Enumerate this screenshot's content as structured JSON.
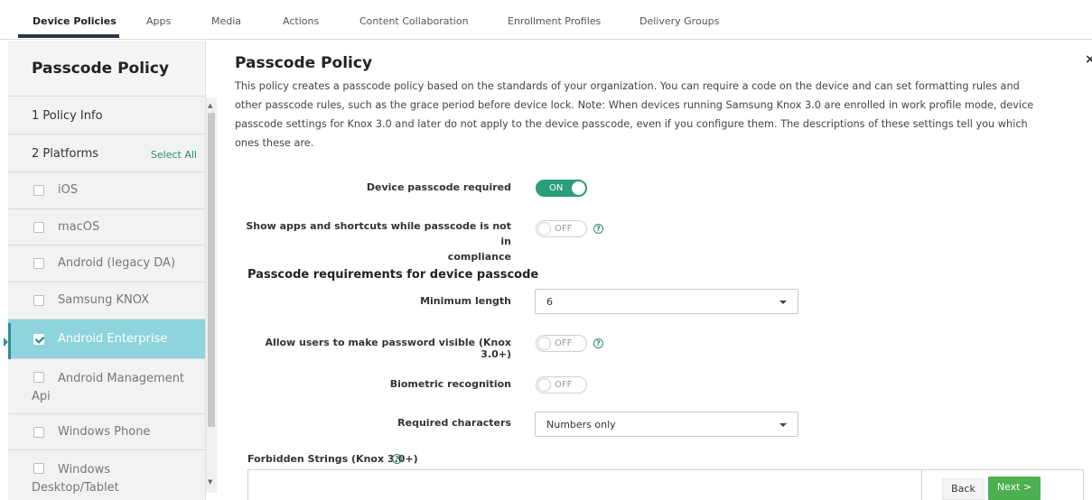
{
  "tabs": [
    "Device Policies",
    "Apps",
    "Media",
    "Actions",
    "Content Collaboration",
    "Enrollment Profiles",
    "Delivery Groups"
  ],
  "sidebar": {
    "title": "Passcode Policy",
    "policy_info": "1  Policy Info",
    "platforms": "2  Platforms",
    "select_all": "Select All",
    "platform_items": [
      "iOS",
      "macOS",
      "Android (legacy DA)",
      "Samsung KNOX",
      "Android Enterprise",
      "Android Management Api",
      "Windows Phone",
      "Windows Desktop/Tablet"
    ],
    "active_item": "Android Enterprise"
  },
  "main": {
    "title": "Passcode Policy",
    "description": "This policy creates a passcode policy based on the standards of your organization. You can require a code on the device and can set formatting rules and other passcode rules, such as the grace period before device lock. Note: When devices running Samsung Knox 3.0 are enrolled in work profile mode, device passcode settings for Knox 3.0 and later do not apply to the device passcode, even if you configure them. The descriptions of these settings tell you which ones these are.",
    "close": "×",
    "device_passcode_required": {
      "label": "Device passcode required",
      "state": "ON"
    },
    "show_apps": {
      "label_line1": "Show apps and shortcuts while passcode is not in",
      "label_line2": "compliance",
      "state": "OFF"
    },
    "section_heading": "Passcode requirements for device passcode",
    "minimum_length": {
      "label": "Minimum length",
      "value": "6"
    },
    "allow_visible": {
      "label": "Allow users to make password visible (Knox 3.0+)",
      "state": "OFF"
    },
    "biometric": {
      "label": "Biometric recognition",
      "state": "OFF"
    },
    "required_chars": {
      "label": "Required characters",
      "value": "Numbers only"
    },
    "forbidden_strings": "Forbidden Strings (Knox 3.0+)"
  },
  "footer": {
    "back": "Back",
    "next": "Next >"
  },
  "colors": {
    "toggle_on": "#2a9d7a",
    "active_item": "#8fd3dc",
    "next_button": "#4caf50"
  }
}
